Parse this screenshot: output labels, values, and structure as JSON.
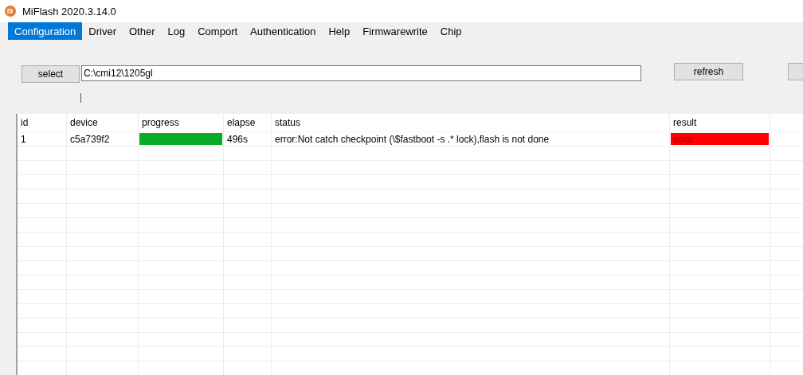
{
  "window": {
    "title": "MiFlash 2020.3.14.0"
  },
  "menu": [
    {
      "label": "Configuration",
      "selected": true
    },
    {
      "label": "Driver",
      "selected": false
    },
    {
      "label": "Other",
      "selected": false
    },
    {
      "label": "Log",
      "selected": false
    },
    {
      "label": "Comport",
      "selected": false
    },
    {
      "label": "Authentication",
      "selected": false
    },
    {
      "label": "Help",
      "selected": false
    },
    {
      "label": "Firmwarewrite",
      "selected": false
    },
    {
      "label": "Chip",
      "selected": false
    }
  ],
  "toolbar": {
    "select_button": "select",
    "path": "C:\\cmi12\\1205gl",
    "refresh_button": "refresh"
  },
  "table": {
    "columns": [
      "id",
      "device",
      "progress",
      "elapse",
      "status",
      "result"
    ],
    "rows": [
      {
        "id": "1",
        "device": "c5a739f2",
        "level": 1,
        "elapse": "496s",
        "status": "error:Not catch checkpoint (\\$fastboot -s .* lock),flash is not done",
        "result": "error",
        "color": "#ff0000"
      }
    ]
  }
}
